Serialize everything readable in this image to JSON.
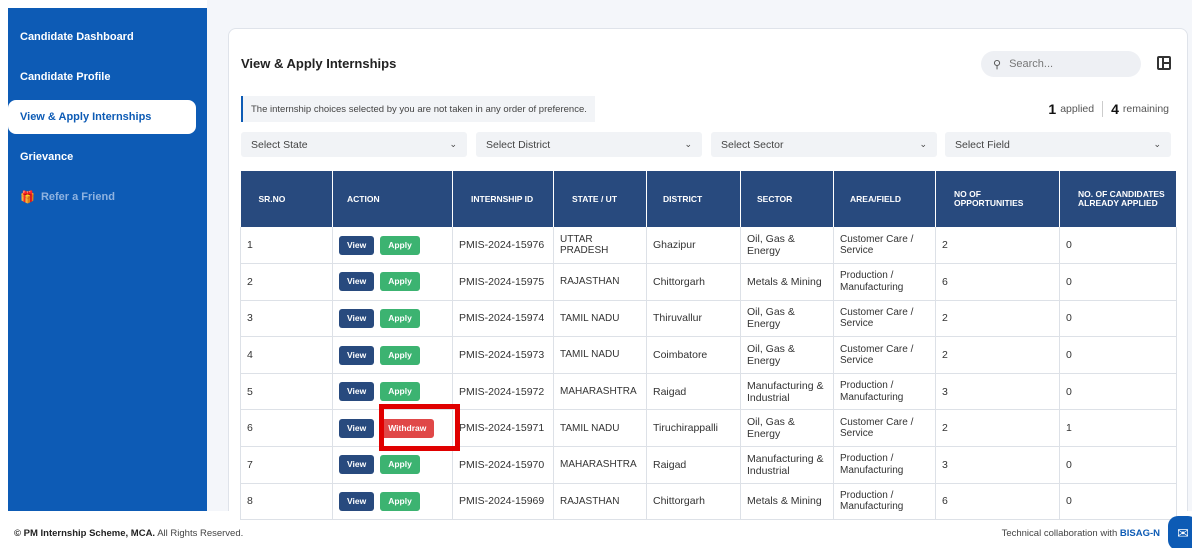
{
  "sidebar": {
    "items": [
      {
        "label": "Candidate Dashboard"
      },
      {
        "label": "Candidate Profile"
      },
      {
        "label": "View & Apply Internships"
      },
      {
        "label": "Grievance"
      },
      {
        "label": "Refer a Friend",
        "icon": "gift-icon"
      }
    ]
  },
  "main": {
    "title": "View & Apply Internships",
    "search_placeholder": "Search...",
    "note": "The internship choices selected by you are not taken in any order of preference.",
    "applied_count": "1",
    "applied_label": "applied",
    "remaining_count": "4",
    "remaining_label": "remaining",
    "filters": [
      "Select State",
      "Select District",
      "Select Sector",
      "Select Field"
    ]
  },
  "table": {
    "headers": [
      "SR.NO",
      "ACTION",
      "INTERNSHIP ID",
      "STATE / UT",
      "DISTRICT",
      "SECTOR",
      "AREA/FIELD",
      "NO OF OPPORTUNITIES",
      "NO. OF CANDIDATES ALREADY APPLIED"
    ],
    "view_label": "View",
    "apply_label": "Apply",
    "withdraw_label": "Withdraw",
    "rows": [
      {
        "sr": "1",
        "action": "Apply",
        "id": "PMIS-2024-15976",
        "state": "UTTAR PRADESH",
        "district": "Ghazipur",
        "sector": "Oil, Gas & Energy",
        "area": "Customer Care / Service",
        "opps": "2",
        "applied": "0"
      },
      {
        "sr": "2",
        "action": "Apply",
        "id": "PMIS-2024-15975",
        "state": "RAJASTHAN",
        "district": "Chittorgarh",
        "sector": "Metals & Mining",
        "area": "Production / Manufacturing",
        "opps": "6",
        "applied": "0"
      },
      {
        "sr": "3",
        "action": "Apply",
        "id": "PMIS-2024-15974",
        "state": "TAMIL NADU",
        "district": "Thiruvallur",
        "sector": "Oil, Gas & Energy",
        "area": "Customer Care / Service",
        "opps": "2",
        "applied": "0"
      },
      {
        "sr": "4",
        "action": "Apply",
        "id": "PMIS-2024-15973",
        "state": "TAMIL NADU",
        "district": "Coimbatore",
        "sector": "Oil, Gas & Energy",
        "area": "Customer Care / Service",
        "opps": "2",
        "applied": "0"
      },
      {
        "sr": "5",
        "action": "Apply",
        "id": "PMIS-2024-15972",
        "state": "MAHARASHTRA",
        "district": "Raigad",
        "sector": "Manufacturing & Industrial",
        "area": "Production / Manufacturing",
        "opps": "3",
        "applied": "0"
      },
      {
        "sr": "6",
        "action": "Withdraw",
        "id": "PMIS-2024-15971",
        "state": "TAMIL NADU",
        "district": "Tiruchirappalli",
        "sector": "Oil, Gas & Energy",
        "area": "Customer Care / Service",
        "opps": "2",
        "applied": "1"
      },
      {
        "sr": "7",
        "action": "Apply",
        "id": "PMIS-2024-15970",
        "state": "MAHARASHTRA",
        "district": "Raigad",
        "sector": "Manufacturing & Industrial",
        "area": "Production / Manufacturing",
        "opps": "3",
        "applied": "0"
      },
      {
        "sr": "8",
        "action": "Apply",
        "id": "PMIS-2024-15969",
        "state": "RAJASTHAN",
        "district": "Chittorgarh",
        "sector": "Metals & Mining",
        "area": "Production / Manufacturing",
        "opps": "6",
        "applied": "0"
      }
    ]
  },
  "footer": {
    "copyright_brand": "© PM Internship Scheme, MCA.",
    "copyright_rest": "All Rights Reserved.",
    "collab_text": "Technical collaboration with",
    "collab_brand": "BISAG-N"
  },
  "colors": {
    "sidebar": "#0d5bb5",
    "table_header": "#284a7e",
    "apply": "#3cb371",
    "withdraw": "#e04848",
    "highlight": "#e00000"
  }
}
